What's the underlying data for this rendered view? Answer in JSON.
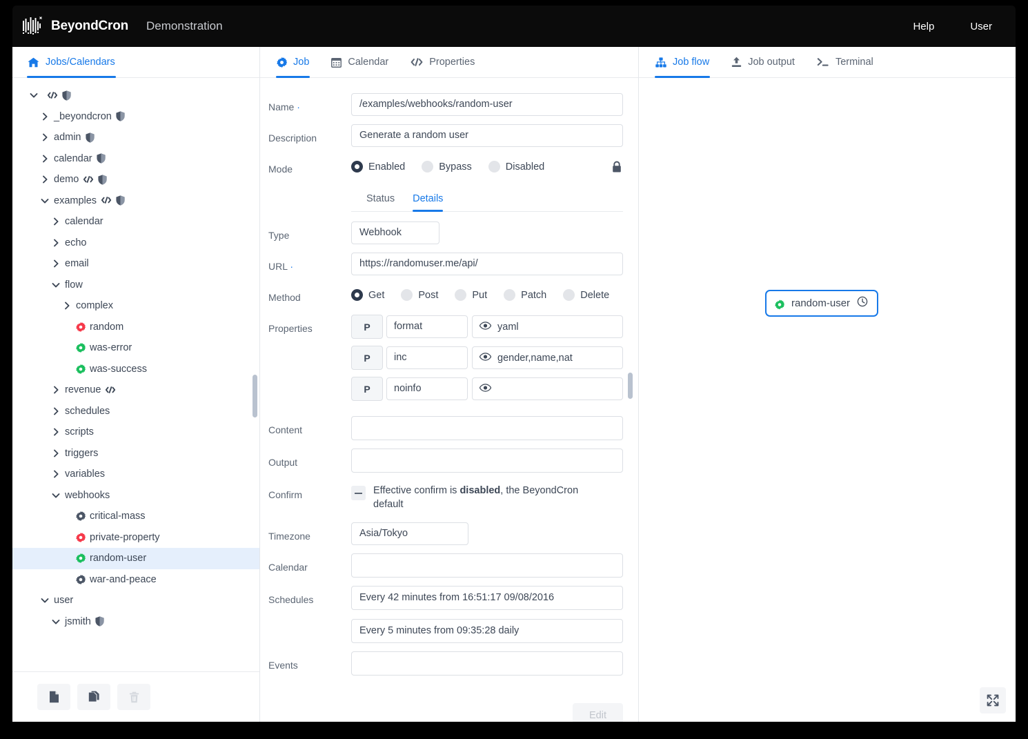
{
  "topbar": {
    "brand": "BeyondCron",
    "subtitle": "Demonstration",
    "help_label": "Help",
    "user_label": "User"
  },
  "left_panel": {
    "tab_label": "Jobs/Calendars",
    "tree": [
      {
        "indent": 0,
        "chevron": "down",
        "label": "",
        "code": true,
        "shield": true
      },
      {
        "indent": 1,
        "chevron": "right",
        "label": "_beyondcron",
        "shield": true
      },
      {
        "indent": 1,
        "chevron": "right",
        "label": "admin",
        "shield": true
      },
      {
        "indent": 1,
        "chevron": "right",
        "label": "calendar",
        "shield": true
      },
      {
        "indent": 1,
        "chevron": "right",
        "label": "demo",
        "code": true,
        "shield": true
      },
      {
        "indent": 1,
        "chevron": "down",
        "label": "examples",
        "code": true,
        "shield": true
      },
      {
        "indent": 2,
        "chevron": "right",
        "label": "calendar"
      },
      {
        "indent": 2,
        "chevron": "right",
        "label": "echo"
      },
      {
        "indent": 2,
        "chevron": "right",
        "label": "email"
      },
      {
        "indent": 2,
        "chevron": "down",
        "label": "flow"
      },
      {
        "indent": 3,
        "chevron": "right",
        "label": "complex"
      },
      {
        "indent": 3,
        "chevron": "none",
        "label": "random",
        "gear": "red"
      },
      {
        "indent": 3,
        "chevron": "none",
        "label": "was-error",
        "gear": "green"
      },
      {
        "indent": 3,
        "chevron": "none",
        "label": "was-success",
        "gear": "green"
      },
      {
        "indent": 2,
        "chevron": "right",
        "label": "revenue",
        "code": true
      },
      {
        "indent": 2,
        "chevron": "right",
        "label": "schedules"
      },
      {
        "indent": 2,
        "chevron": "right",
        "label": "scripts"
      },
      {
        "indent": 2,
        "chevron": "right",
        "label": "triggers"
      },
      {
        "indent": 2,
        "chevron": "right",
        "label": "variables"
      },
      {
        "indent": 2,
        "chevron": "down",
        "label": "webhooks"
      },
      {
        "indent": 3,
        "chevron": "none",
        "label": "critical-mass",
        "gear": "gray"
      },
      {
        "indent": 3,
        "chevron": "none",
        "label": "private-property",
        "gear": "red"
      },
      {
        "indent": 3,
        "chevron": "none",
        "label": "random-user",
        "gear": "green",
        "selected": true
      },
      {
        "indent": 3,
        "chevron": "none",
        "label": "war-and-peace",
        "gear": "gray"
      },
      {
        "indent": 1,
        "chevron": "down",
        "label": "user"
      },
      {
        "indent": 2,
        "chevron": "down",
        "label": "jsmith",
        "shield": true
      }
    ],
    "toolbar": [
      {
        "icon": "new-file-icon",
        "enabled": true
      },
      {
        "icon": "copy-icon",
        "enabled": true
      },
      {
        "icon": "trash-icon",
        "enabled": false
      }
    ]
  },
  "mid_panel": {
    "tabs": [
      {
        "label": "Job",
        "icon": "gear-icon",
        "active": true
      },
      {
        "label": "Calendar",
        "icon": "calendar-icon",
        "active": false
      },
      {
        "label": "Properties",
        "icon": "code-icon",
        "active": false
      }
    ],
    "fields": {
      "name_label": "Name",
      "name_value": "/examples/webhooks/random-user",
      "description_label": "Description",
      "description_value": "Generate a random user",
      "mode_label": "Mode",
      "type_label": "Type",
      "type_value": "Webhook",
      "url_label": "URL",
      "url_value": "https://randomuser.me/api/",
      "method_label": "Method",
      "properties_label": "Properties",
      "content_label": "Content",
      "content_value": "",
      "output_label": "Output",
      "output_value": "",
      "confirm_label": "Confirm",
      "confirm_text_pre": "Effective confirm is ",
      "confirm_text_bold": "disabled",
      "confirm_text_post": ", the BeyondCron default",
      "timezone_label": "Timezone",
      "timezone_value": "Asia/Tokyo",
      "calendar_label": "Calendar",
      "calendar_value": "",
      "schedules_label": "Schedules",
      "schedule_1": "Every 42 minutes from 16:51:17 09/08/2016",
      "schedule_2": "Every 5 minutes from 09:35:28 daily",
      "events_label": "Events",
      "events_value": ""
    },
    "mode_options": [
      {
        "label": "Enabled",
        "selected": true
      },
      {
        "label": "Bypass",
        "selected": false
      },
      {
        "label": "Disabled",
        "selected": false
      }
    ],
    "subtabs": [
      {
        "label": "Status",
        "active": false
      },
      {
        "label": "Details",
        "active": true
      }
    ],
    "method_options": [
      {
        "label": "Get",
        "selected": true
      },
      {
        "label": "Post",
        "selected": false
      },
      {
        "label": "Put",
        "selected": false
      },
      {
        "label": "Patch",
        "selected": false
      },
      {
        "label": "Delete",
        "selected": false
      }
    ],
    "properties": [
      {
        "badge": "P",
        "key": "format",
        "value": "yaml"
      },
      {
        "badge": "P",
        "key": "inc",
        "value": "gender,name,nat"
      },
      {
        "badge": "P",
        "key": "noinfo",
        "value": ""
      }
    ],
    "edit_label": "Edit"
  },
  "right_panel": {
    "tabs": [
      {
        "label": "Job flow",
        "icon": "sitemap-icon",
        "active": true
      },
      {
        "label": "Job output",
        "icon": "upload-icon",
        "active": false
      },
      {
        "label": "Terminal",
        "icon": "terminal-icon",
        "active": false
      }
    ],
    "node": {
      "label": "random-user",
      "gear_color": "green",
      "badge_icon": "clock-icon"
    }
  },
  "colors": {
    "accent": "#1779e8",
    "green": "#1bbf5e",
    "red": "#f6394a",
    "gray_icon": "#5b6573",
    "text": "#3d4756",
    "muted": "#5b6573",
    "selection_bg": "#e5effc",
    "topbar_bg": "#0b0b0b"
  }
}
